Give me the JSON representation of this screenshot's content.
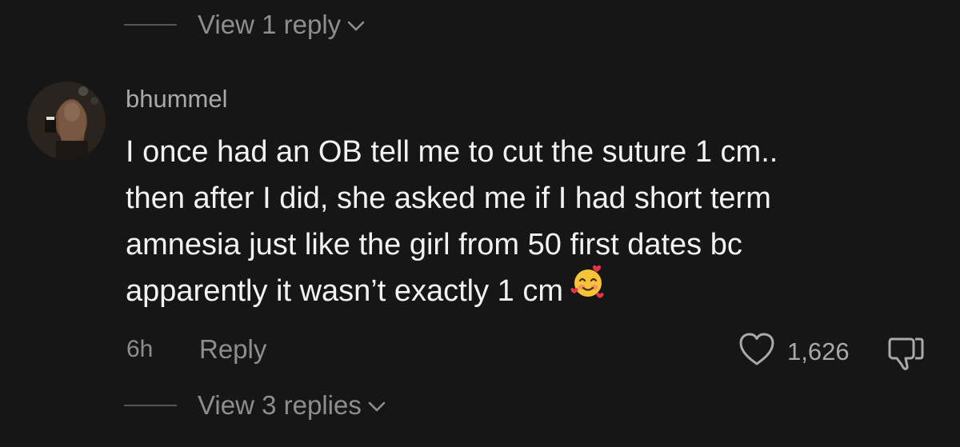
{
  "thread": {
    "top_view_replies": "View 1 reply",
    "bottom_view_replies": "View 3 replies"
  },
  "comment": {
    "username": "bhummel",
    "text_lines": [
      "I once had an OB tell me to cut the suture 1 cm..",
      "then after I did, she asked me if I had short term",
      "amnesia just like the girl from 50 first dates bc",
      "apparently it wasn’t exactly 1 cm"
    ],
    "emoji": "smiling-face-with-hearts",
    "time": "6h",
    "reply_label": "Reply",
    "like_count": "1,626"
  },
  "icons": {
    "chevron": "chevron-down-icon",
    "like": "heart-outline-icon",
    "dislike": "thumbs-down-icon"
  },
  "colors": {
    "background": "#161616",
    "text_primary": "#f2f2f2",
    "text_secondary": "#8e8e8e"
  }
}
